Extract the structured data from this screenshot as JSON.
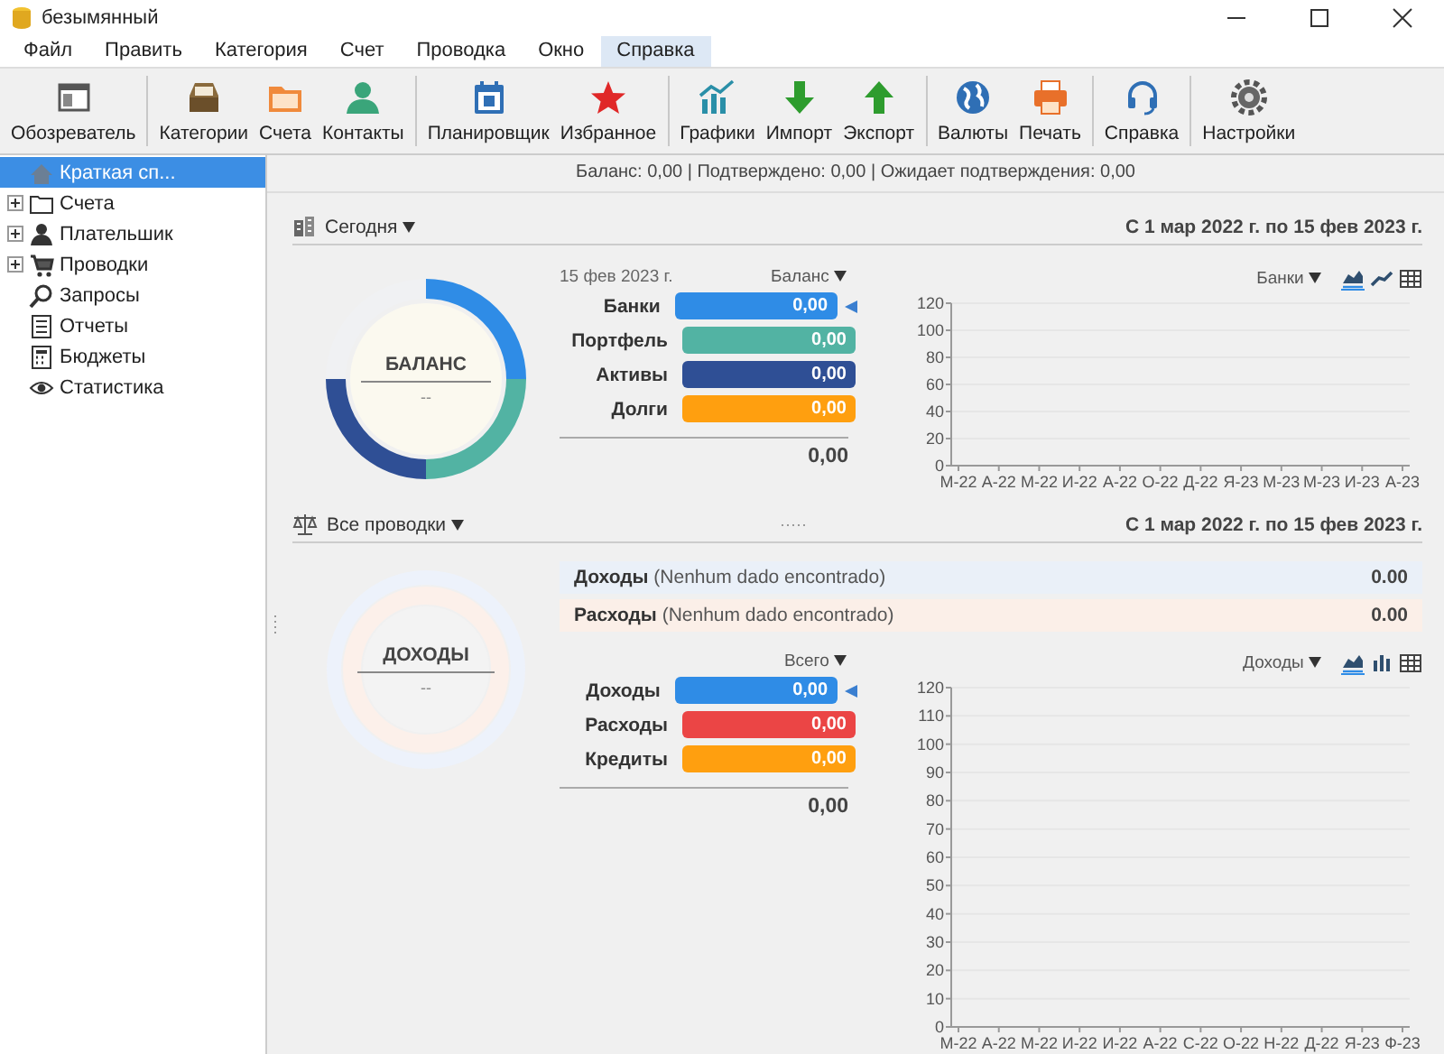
{
  "window": {
    "title": "безымянный"
  },
  "menu": [
    {
      "label": "Файл",
      "selected": false
    },
    {
      "label": "Править",
      "selected": false
    },
    {
      "label": "Категория",
      "selected": false
    },
    {
      "label": "Счет",
      "selected": false
    },
    {
      "label": "Проводка",
      "selected": false
    },
    {
      "label": "Окно",
      "selected": false
    },
    {
      "label": "Справка",
      "selected": true
    }
  ],
  "toolbar": [
    [
      {
        "label": "Обозреватель"
      }
    ],
    [
      {
        "label": "Категории"
      },
      {
        "label": "Счета"
      },
      {
        "label": "Контакты"
      }
    ],
    [
      {
        "label": "Планировщик"
      },
      {
        "label": "Избранное"
      }
    ],
    [
      {
        "label": "Графики"
      },
      {
        "label": "Импорт"
      },
      {
        "label": "Экспорт"
      }
    ],
    [
      {
        "label": "Валюты"
      },
      {
        "label": "Печать"
      }
    ],
    [
      {
        "label": "Справка"
      }
    ],
    [
      {
        "label": "Настройки"
      }
    ]
  ],
  "sidebar": {
    "items": [
      {
        "label": "Краткая сп...",
        "selected": true
      },
      {
        "label": "Счета",
        "selected": false,
        "expanded": false
      },
      {
        "label": "Плательшик",
        "selected": false,
        "expanded": false
      },
      {
        "label": "Проводки",
        "selected": false,
        "expanded": false
      },
      {
        "label": "Запросы",
        "selected": false
      },
      {
        "label": "Отчеты",
        "selected": false
      },
      {
        "label": "Бюджеты",
        "selected": false
      },
      {
        "label": "Статистика",
        "selected": false
      }
    ]
  },
  "summary": "Баланс: 0,00 | Подтверждено: 0,00 | Ожидает подтверждения: 0,00",
  "balance_section": {
    "period": "Сегодня",
    "range": "С 1 мар 2022 г. по 15 фев 2023 г.",
    "donut": {
      "title": "БАЛАНС",
      "value": "--"
    },
    "date": "15 фев 2023 г.",
    "mode": "Баланс",
    "rows": [
      {
        "label": "Банки",
        "value": "0,00",
        "color": "#2f8ce6",
        "selected": true
      },
      {
        "label": "Портфель",
        "value": "0,00",
        "color": "#52b3a3",
        "selected": false
      },
      {
        "label": "Активы",
        "value": "0,00",
        "color": "#2f4f95",
        "selected": false
      },
      {
        "label": "Долги",
        "value": "0,00",
        "color": "#ff9f0f",
        "selected": false
      }
    ],
    "total": "0,00",
    "chart_filter": "Банки",
    "chart_views": [
      {
        "selected": true
      },
      {
        "selected": false
      },
      {
        "selected": false
      }
    ],
    "chart_data": {
      "type": "area",
      "categories": [
        "М-22",
        "А-22",
        "М-22",
        "И-22",
        "А-22",
        "О-22",
        "Д-22",
        "Я-23",
        "М-23",
        "М-23",
        "И-23",
        "А-23"
      ],
      "ylim": [
        0,
        120
      ],
      "yticks": [
        0,
        20,
        40,
        60,
        80,
        100,
        120
      ],
      "grid": true
    }
  },
  "transactions_section": {
    "period": "Все проводки",
    "range": "С 1 мар 2022 г. по 15 фев 2023 г.",
    "summary_rows": [
      {
        "text": "**Доходы** (Nenhum dado encontrado)",
        "value": "0.00",
        "color": "#eaf0f8"
      },
      {
        "text": "**Расходы** (Nenhum dado encontrado)",
        "value": "0.00",
        "color": "#fbefe8"
      }
    ],
    "donut": {
      "title": "ДОХОДЫ",
      "value": "--"
    },
    "mode": "Всего",
    "rows": [
      {
        "label": "Доходы",
        "value": "0,00",
        "color": "#2f8ce6",
        "selected": true
      },
      {
        "label": "Расходы",
        "value": "0,00",
        "color": "#eb4545",
        "selected": false
      },
      {
        "label": "Кредиты",
        "value": "0,00",
        "color": "#ff9f0f",
        "selected": false
      }
    ],
    "total": "0,00",
    "chart_filter": "Доходы",
    "chart_views": [
      {
        "selected": true
      },
      {
        "selected": false
      },
      {
        "selected": false
      }
    ],
    "chart_data": {
      "type": "area",
      "categories": [
        "М-22",
        "А-22",
        "М-22",
        "И-22",
        "И-22",
        "А-22",
        "С-22",
        "О-22",
        "Н-22",
        "Д-22",
        "Я-23",
        "Ф-23"
      ],
      "ylim": [
        0,
        120
      ],
      "yticks": [
        0,
        10,
        20,
        30,
        40,
        50,
        60,
        70,
        80,
        90,
        100,
        110,
        120
      ],
      "grid": true
    }
  }
}
